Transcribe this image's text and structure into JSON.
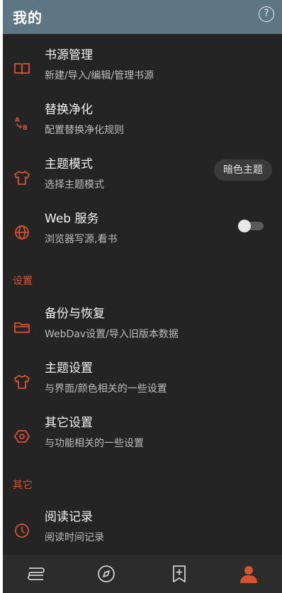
{
  "header": {
    "title": "我的",
    "help_glyph": "?"
  },
  "colors": {
    "accent": "#d6532f",
    "background": "#242424",
    "header": "#5c7783",
    "nav": "#2c2c2c"
  },
  "items": [
    {
      "icon": "book-icon",
      "title": "书源管理",
      "subtitle": "新建/导入/编辑/管理书源"
    },
    {
      "icon": "translate-icon",
      "title": "替换净化",
      "subtitle": "配置替换净化规则"
    },
    {
      "icon": "shirt-icon",
      "title": "主题模式",
      "subtitle": "选择主题模式",
      "value": "暗色主题"
    },
    {
      "icon": "globe-icon",
      "title": "Web 服务",
      "subtitle": "浏览器写源,看书",
      "toggle_on": false
    },
    {
      "icon": "folder-icon",
      "title": "备份与恢复",
      "subtitle": "WebDav设置/导入旧版本数据"
    },
    {
      "icon": "shirt-icon",
      "title": "主题设置",
      "subtitle": "与界面/颜色相关的一些设置"
    },
    {
      "icon": "hexagon-settings-icon",
      "title": "其它设置",
      "subtitle": "与功能相关的一些设置"
    },
    {
      "icon": "clock-icon",
      "title": "阅读记录",
      "subtitle": "阅读时间记录"
    }
  ],
  "sections": {
    "settings": "设置",
    "other": "其它"
  },
  "bottom_nav": [
    {
      "icon": "bookshelf-icon",
      "active": false
    },
    {
      "icon": "compass-icon",
      "active": false
    },
    {
      "icon": "bookmark-add-icon",
      "active": false
    },
    {
      "icon": "user-icon",
      "active": true
    }
  ]
}
